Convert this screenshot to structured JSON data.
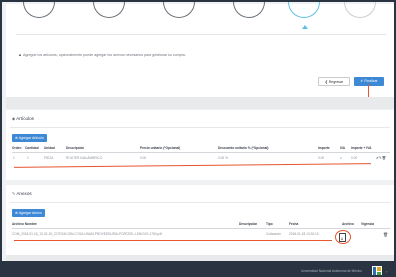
{
  "wizard": {
    "info_icon": "warning-icon",
    "info_text": "Agregue los artículos; opcionalmente puede agregar los anexos necesarios para gestionar su compra.",
    "back_label": "Regresar",
    "back_icon": "chevron-left-icon",
    "finish_label": "Finalizar",
    "finish_icon": "check-icon"
  },
  "articulos": {
    "title": "Artículos",
    "title_icon": "tag-icon",
    "add_label": "Agregar Artículo",
    "columns": [
      "Orden",
      "Cantidad",
      "Unidad",
      "Descripción",
      "Precio unitario (*Opcional)",
      "Descuento unitario % (*Opcional)",
      "Importe",
      "IVA",
      "Importe + IVA"
    ],
    "rows": [
      {
        "orden": "1",
        "cantidad": "1",
        "unidad": "PIEZA",
        "descripcion": "ROUTER INALÁMBRICO",
        "precio": "0.00",
        "descuento": "0.00 %",
        "importe": "0.00",
        "iva": "✔",
        "importe_iva": "0.00"
      }
    ]
  },
  "anexos": {
    "title": "Anexos",
    "title_icon": "paperclip-icon",
    "add_label": "Agregar Anexo",
    "columns": [
      "Archivo Nombre",
      "Descripción",
      "Tipo",
      "Fecha",
      "Archivo",
      "Vigencia"
    ],
    "rows": [
      {
        "nombre": "COM_2018-01-18_13-32-15_COTIZACION-CYSA-UNAM-PROVEEDURIA-PORTATIL-LENOVO-1750.pdf",
        "descripcion": "",
        "tipo": "Cotización",
        "fecha": "2018-01-18 13:32:15",
        "archivo_icon": "pdf-file-icon",
        "vigencia": ""
      }
    ]
  },
  "footer": {
    "text": "Universidad Nacional Autónoma de México"
  },
  "colors": {
    "accent": "#3e89d6",
    "annotation": "#e8552f",
    "footer": "#2a3342",
    "active_step": "#5bc2e7"
  }
}
